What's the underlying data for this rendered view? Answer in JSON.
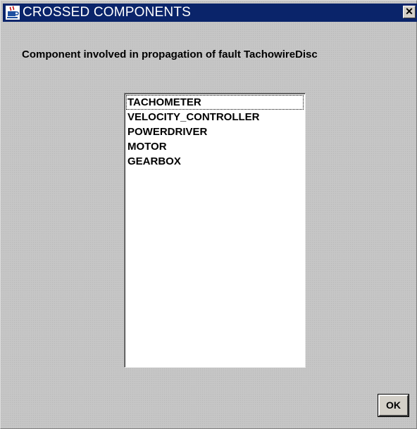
{
  "window": {
    "title": "CROSSED COMPONENTS",
    "close_label": "✕"
  },
  "icons": {
    "app": "java-cup-icon",
    "close": "close-icon"
  },
  "message": "Component involved in propagation of fault TachowireDisc",
  "components": [
    "TACHOMETER",
    "VELOCITY_CONTROLLER",
    "POWERDRIVER",
    "MOTOR",
    "GEARBOX"
  ],
  "buttons": {
    "ok": "OK"
  },
  "colors": {
    "titlebar": "#0a246a",
    "background": "#c6c6c6"
  }
}
